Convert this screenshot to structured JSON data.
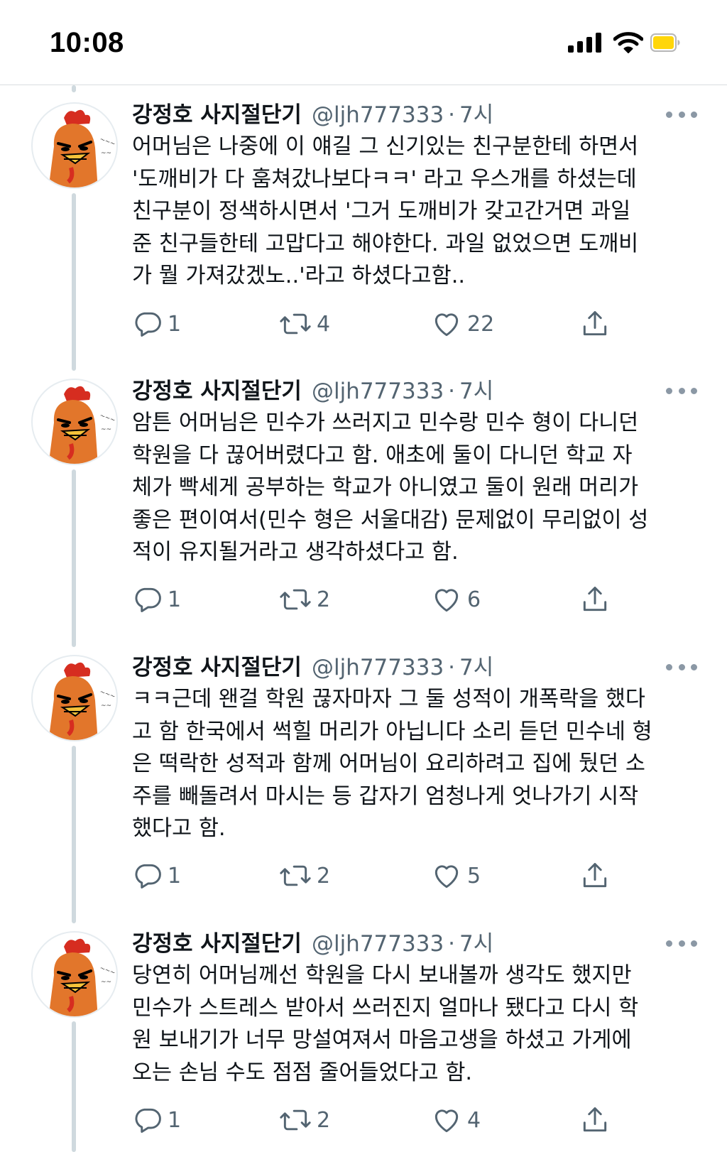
{
  "status_bar": {
    "time": "10:08"
  },
  "colors": {
    "text": "#0f1419",
    "secondary": "#536471",
    "thread_line": "#cfd9de",
    "battery": "#ffd60a",
    "avatar_accent": "#e2762b"
  },
  "tweets": [
    {
      "display_name": "강정호 사지절단기",
      "handle": "@ljh777333",
      "separator": "·",
      "time": "7시",
      "text": "어머님은 나중에 이 얘길 그 신기있는 친구분한테 하면서\n'도깨비가 다 훔쳐갔나보다ㅋㅋ' 라고 우스개를 하셨는데\n친구분이 정색하시면서 '그거 도깨비가 갖고간거면 과일\n준 친구들한테 고맙다고 해야한다. 과일 없었으면 도깨비\n가 뭘 가져갔겠노..'라고 하셨다고함..",
      "replies": "1",
      "retweets": "4",
      "likes": "22"
    },
    {
      "display_name": "강정호 사지절단기",
      "handle": "@ljh777333",
      "separator": "·",
      "time": "7시",
      "text": "암튼 어머님은 민수가 쓰러지고 민수랑 민수 형이 다니던\n학원을 다 끊어버렸다고 함. 애초에 둘이 다니던 학교 자\n체가 빡세게 공부하는 학교가 아니였고 둘이 원래 머리가\n좋은 편이여서(민수 형은 서울대감) 문제없이 무리없이 성\n적이 유지될거라고 생각하셨다고 함.",
      "replies": "1",
      "retweets": "2",
      "likes": "6"
    },
    {
      "display_name": "강정호 사지절단기",
      "handle": "@ljh777333",
      "separator": "·",
      "time": "7시",
      "text": "ㅋㅋ근데 왠걸 학원 끊자마자 그 둘 성적이 개폭락을 했다\n고 함 한국에서 썩힐 머리가 아닙니다 소리 듣던 민수네 형\n은 떡락한 성적과 함께 어머님이 요리하려고 집에 뒀던 소\n주를 빼돌려서 마시는 등 갑자기 엄청나게 엇나가기 시작\n했다고 함.",
      "replies": "1",
      "retweets": "2",
      "likes": "5"
    },
    {
      "display_name": "강정호 사지절단기",
      "handle": "@ljh777333",
      "separator": "·",
      "time": "7시",
      "text": "당연히 어머님께선 학원을 다시 보내볼까 생각도 했지만\n민수가 스트레스 받아서 쓰러진지 얼마나 됐다고 다시 학\n원 보내기가 너무 망설여져서 마음고생을 하셨고 가게에\n오는 손님 수도 점점 줄어들었다고 함.",
      "replies": "1",
      "retweets": "2",
      "likes": "4"
    }
  ]
}
